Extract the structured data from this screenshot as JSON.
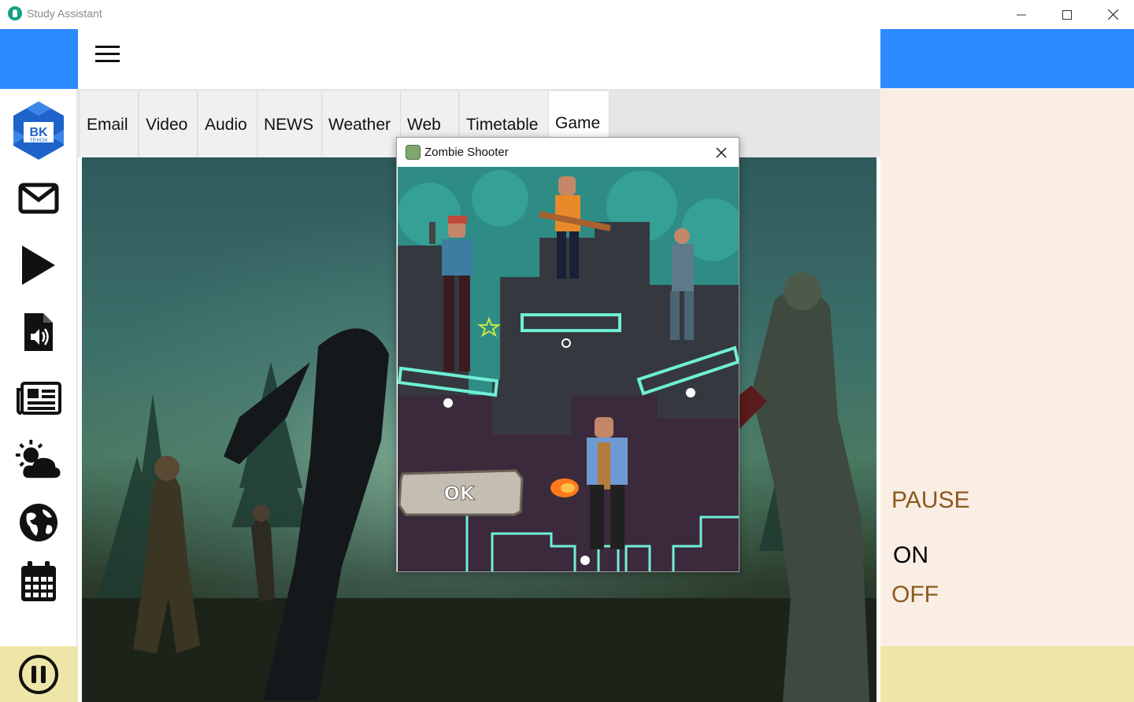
{
  "app": {
    "title": "Study Assistant"
  },
  "window_controls": {
    "minimize": "—",
    "maximize": "☐",
    "close": "✕"
  },
  "tabs": [
    {
      "label": "Email",
      "active": false
    },
    {
      "label": "Video",
      "active": false
    },
    {
      "label": "Audio",
      "active": false
    },
    {
      "label": "NEWS",
      "active": false
    },
    {
      "label": "Weather",
      "active": false
    },
    {
      "label": "Web",
      "active": false
    },
    {
      "label": "Timetable",
      "active": false
    },
    {
      "label": "Game",
      "active": true
    }
  ],
  "sidebar": {
    "logo_text": "BK",
    "logo_subtext": "TP.HCM",
    "items": [
      {
        "icon": "mail-icon"
      },
      {
        "icon": "play-icon"
      },
      {
        "icon": "audio-file-icon"
      },
      {
        "icon": "newspaper-icon"
      },
      {
        "icon": "weather-icon"
      },
      {
        "icon": "globe-icon"
      },
      {
        "icon": "calendar-icon"
      }
    ],
    "bottom_icon": "pause-circle-icon"
  },
  "right_panel": {
    "pause_label": "PAUSE",
    "on_label": "ON",
    "off_label": "OFF"
  },
  "dialog": {
    "title": "Zombie Shooter",
    "ok_label": "OK"
  },
  "colors": {
    "header_blue": "#2b8bff",
    "right_panel_bg": "#f9ede4",
    "bottom_bar": "#ede6a8",
    "pause_text": "#8a5a1e",
    "game_teal": "#2e8c85",
    "game_dark": "#3a3d45",
    "game_purple": "#3e2a3e",
    "neon_outline": "#6ff0d6"
  }
}
